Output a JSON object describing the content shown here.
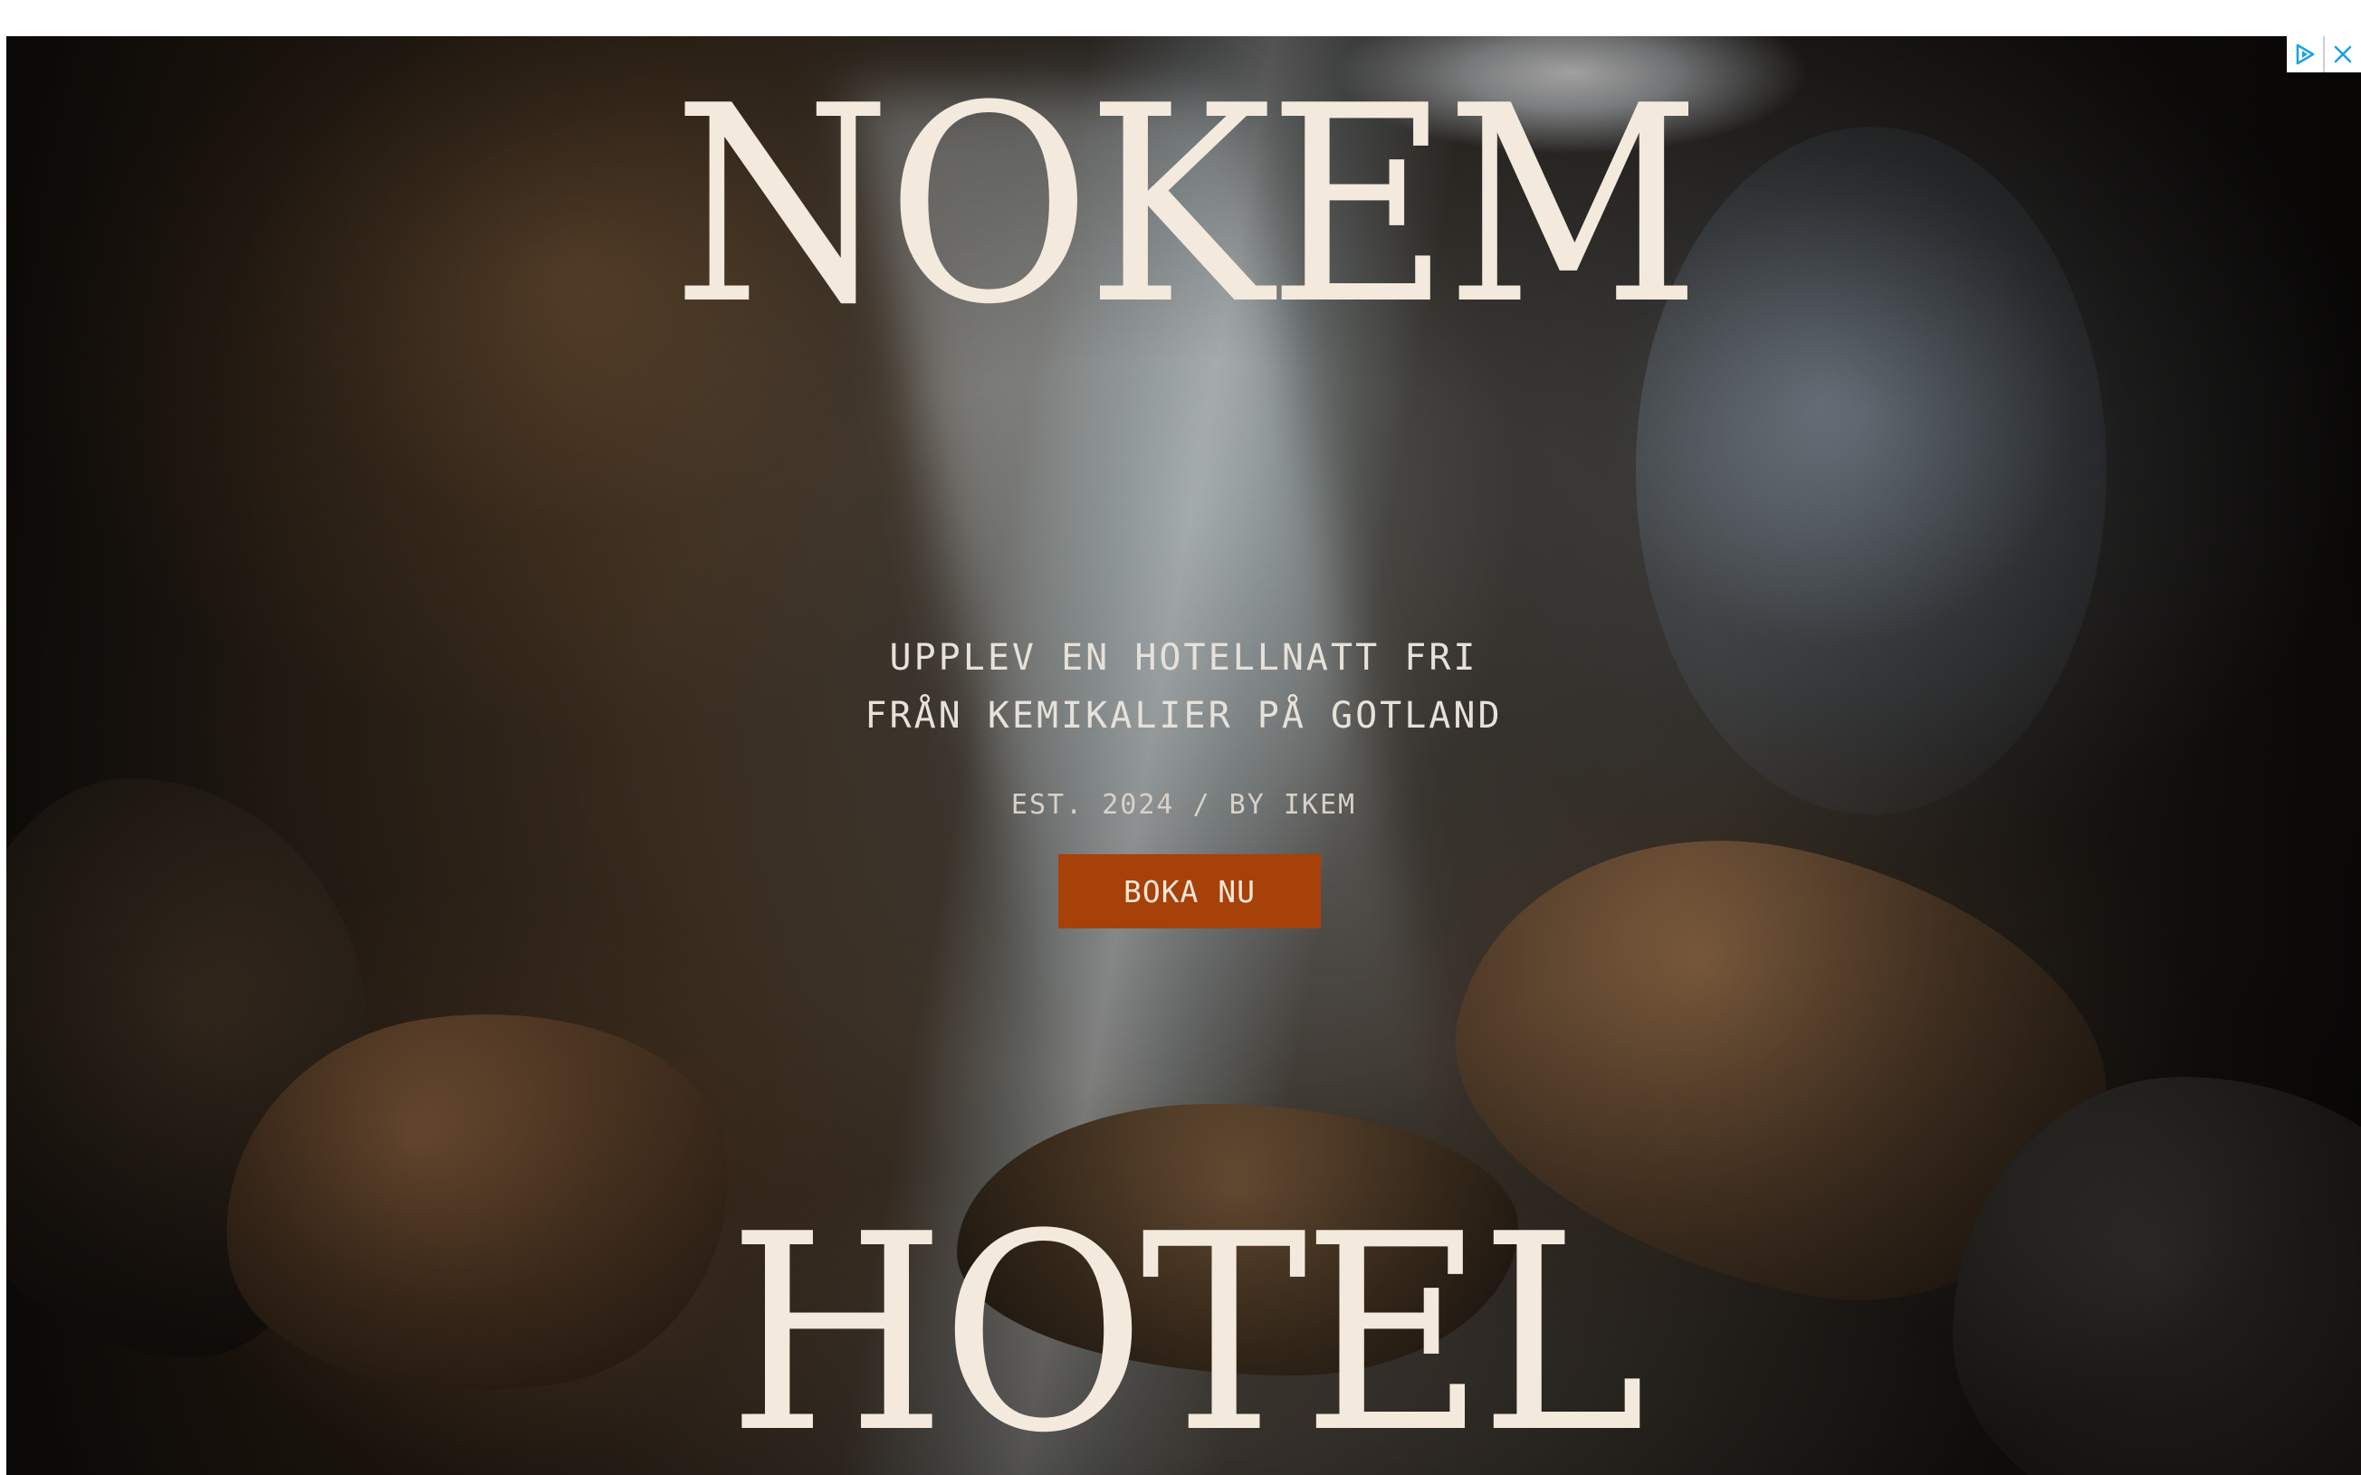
{
  "ad": {
    "brand_top": "NOKEM",
    "brand_bottom": "HOTEL",
    "tagline_line1": "UPPLEV EN HOTELLNATT FRI",
    "tagline_line2": "FRÅN KEMIKALIER PÅ GOTLAND",
    "established": "EST. 2024 / BY IKEM",
    "cta_label": "BOKA NU",
    "colors": {
      "brand_text": "#f3e9dc",
      "cta_background": "#a7410a",
      "adchoices_icon": "#1aa3df"
    }
  },
  "ad_controls": {
    "icons": [
      "adchoices-icon",
      "close-icon"
    ]
  }
}
